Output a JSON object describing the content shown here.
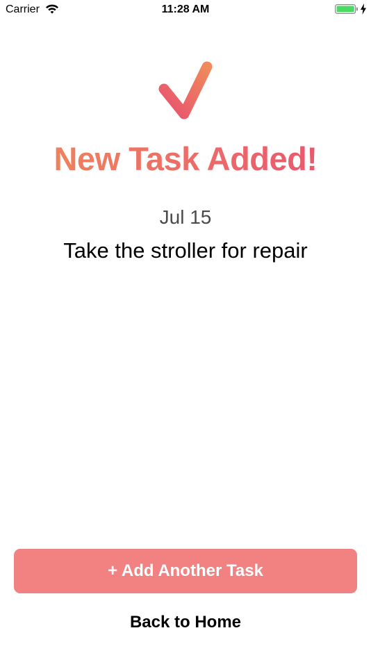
{
  "status_bar": {
    "carrier": "Carrier",
    "time": "11:28 AM",
    "icons": [
      "wifi-icon",
      "battery-icon",
      "charging-bolt-icon"
    ],
    "battery_color": "#4cd964"
  },
  "confirmation": {
    "icon": "checkmark-icon",
    "headline": "New Task Added!",
    "date": "Jul 15",
    "task_title": "Take the stroller for repair"
  },
  "actions": {
    "add_another_label": "+ Add Another Task",
    "back_home_label": "Back to Home"
  },
  "colors": {
    "gradient_start": "#ef8a5a",
    "gradient_end": "#e8516f",
    "button_bg": "#f28282",
    "button_text": "#ffffff"
  }
}
